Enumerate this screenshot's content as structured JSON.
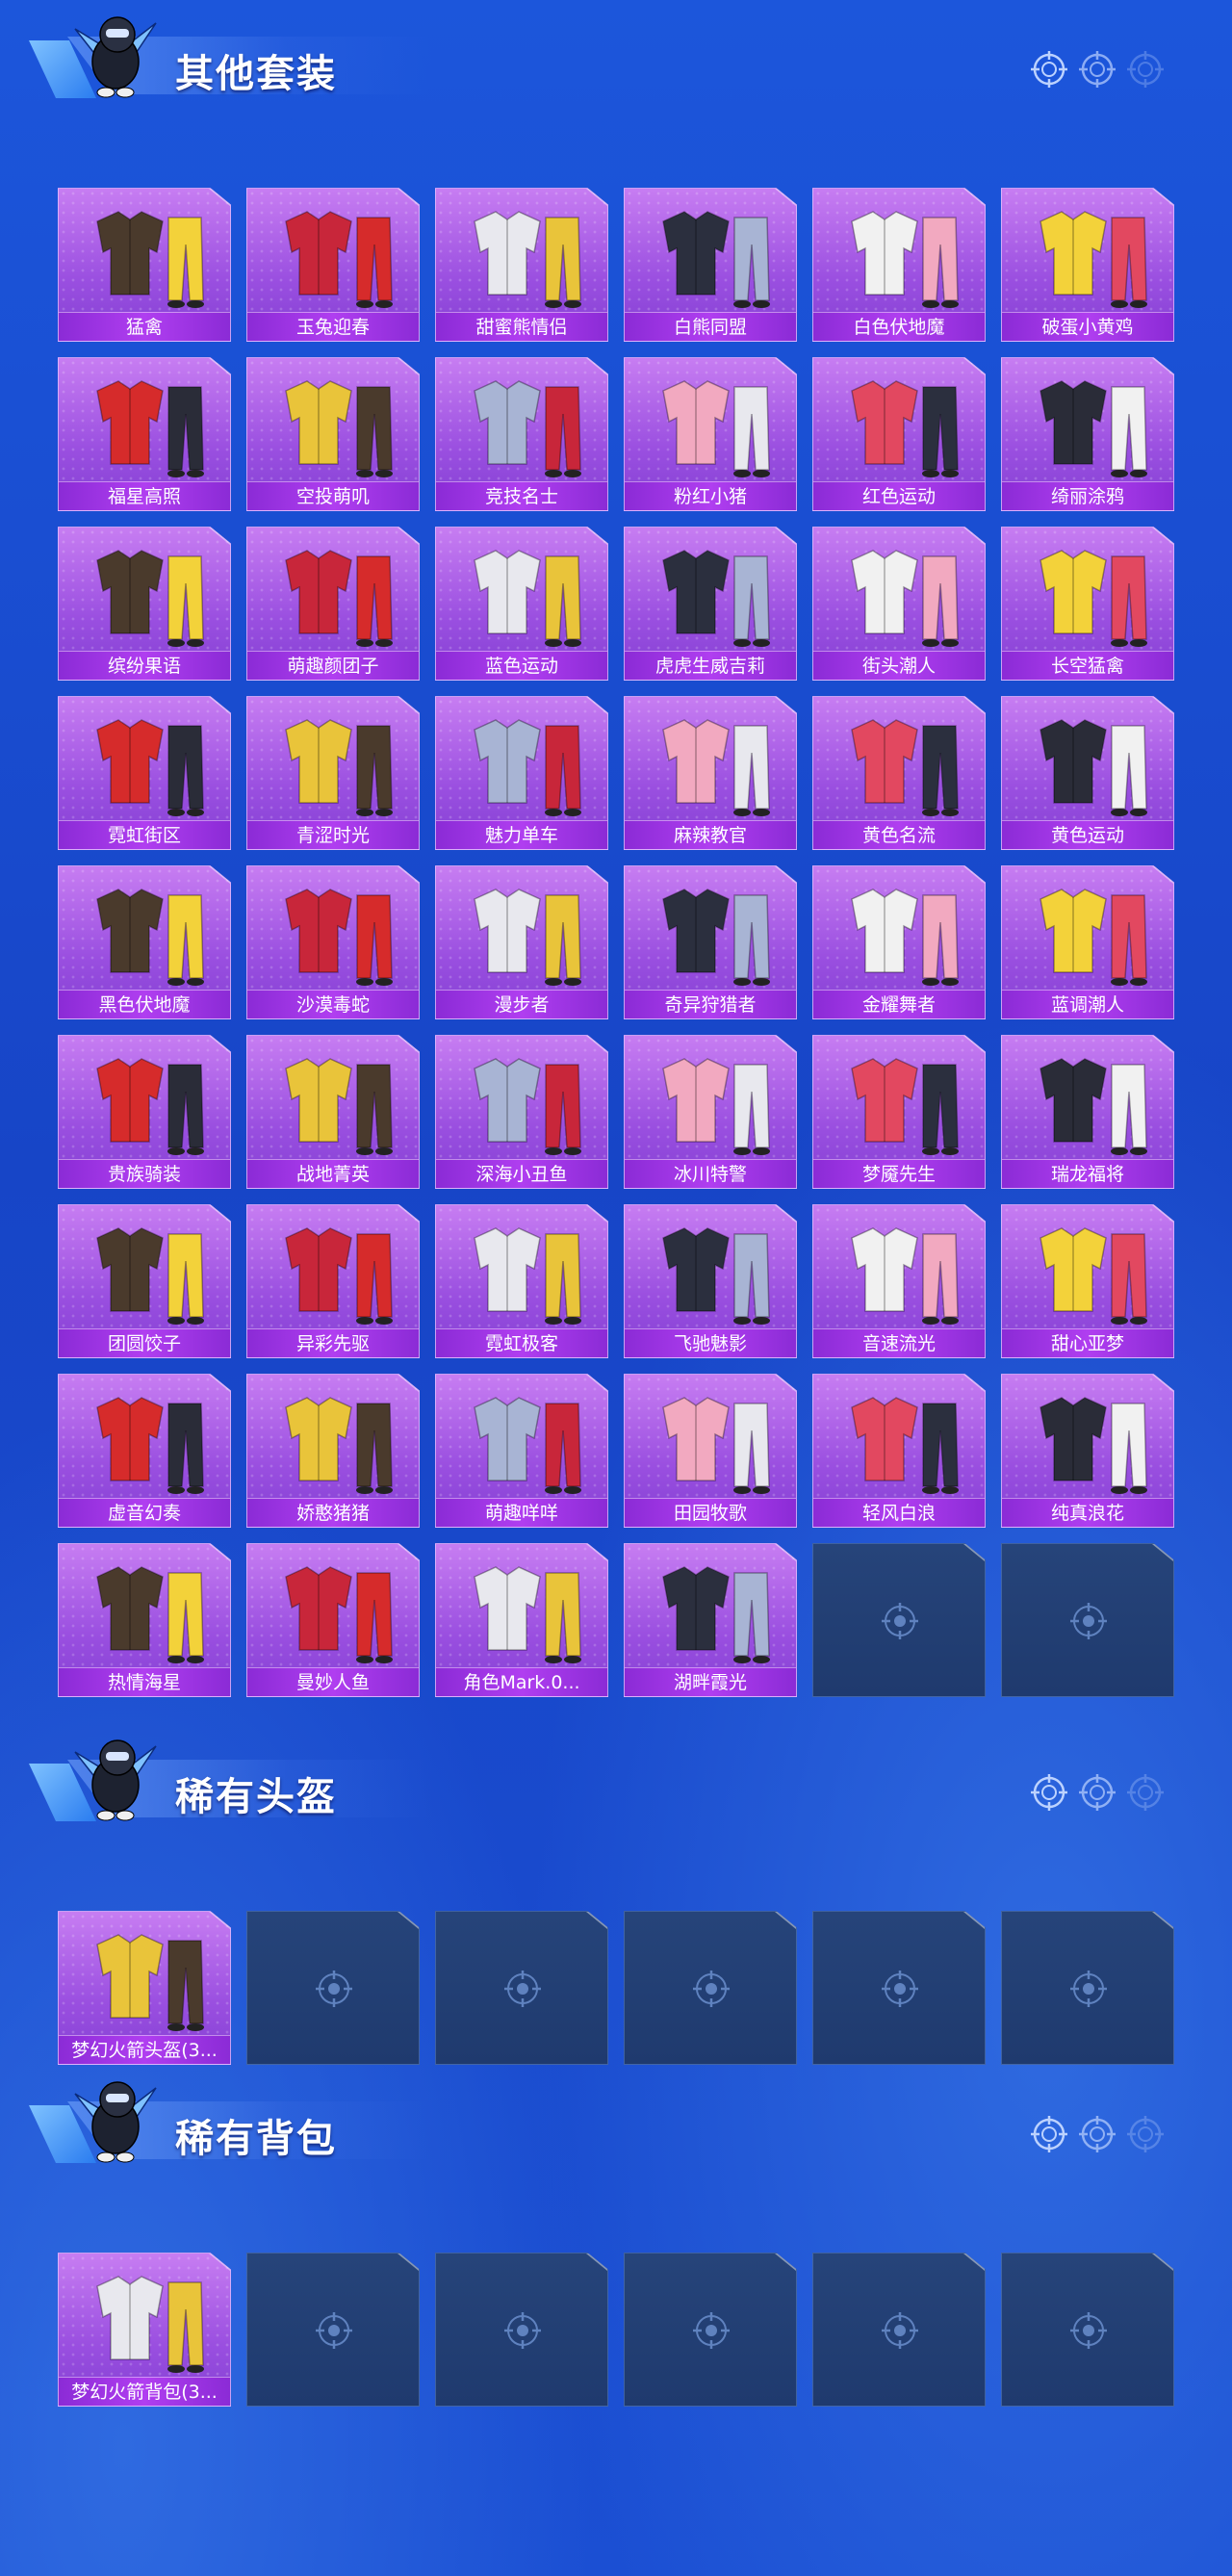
{
  "colors": {
    "bg": "#1b4fd3",
    "tile_filled": "#a658e6",
    "tile_label_bar": "#9b35e4",
    "tile_empty": "#233f74"
  },
  "sections": [
    {
      "title": "其他套装",
      "items": [
        "猛禽",
        "玉兔迎春",
        "甜蜜熊情侣",
        "白熊同盟",
        "白色伏地魔",
        "破蛋小黄鸡",
        "福星高照",
        "空投萌叽",
        "竞技名士",
        "粉红小猪",
        "红色运动",
        "绮丽涂鸦",
        "缤纷果语",
        "萌趣颜团子",
        "蓝色运动",
        "虎虎生威吉莉",
        "街头潮人",
        "长空猛禽",
        "霓虹街区",
        "青涩时光",
        "魅力单车",
        "麻辣教官",
        "黄色名流",
        "黄色运动",
        "黑色伏地魔",
        "沙漠毒蛇",
        "漫步者",
        "奇异狩猎者",
        "金耀舞者",
        "蓝调潮人",
        "贵族骑装",
        "战地菁英",
        "深海小丑鱼",
        "冰川特警",
        "梦魇先生",
        "瑞龙福将",
        "团圆饺子",
        "异彩先驱",
        "霓虹极客",
        "飞驰魅影",
        "音速流光",
        "甜心亚梦",
        "虚音幻奏",
        "娇憨猪猪",
        "萌趣咩咩",
        "田园牧歌",
        "轻风白浪",
        "纯真浪花",
        "热情海星",
        "曼妙人鱼",
        "角色Mark.0...",
        "湖畔霞光"
      ],
      "empty_slots": 2
    },
    {
      "title": "稀有头盔",
      "items": [
        "梦幻火箭头盔(3..."
      ],
      "empty_slots": 5
    },
    {
      "title": "稀有背包",
      "items": [
        "梦幻火箭背包(3..."
      ],
      "empty_slots": 5
    }
  ]
}
